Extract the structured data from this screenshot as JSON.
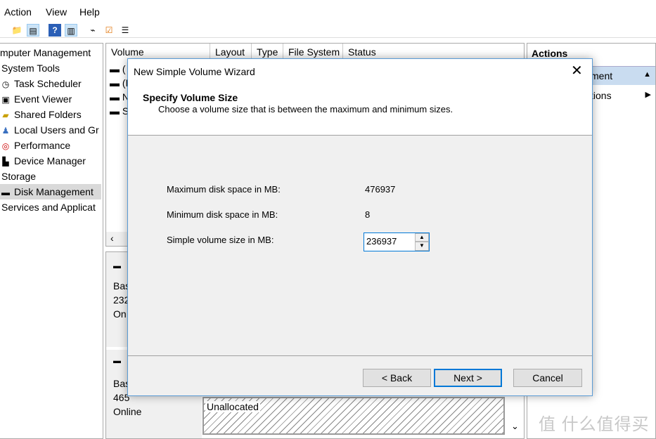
{
  "menu": [
    "Action",
    "View",
    "Help"
  ],
  "toolbar": [
    "up-folder-icon",
    "show-hide-tree-icon",
    "help-icon",
    "show-hide-action-icon",
    "connect-icon",
    "checklist-icon",
    "properties-icon"
  ],
  "tree": {
    "items": [
      {
        "label": "mputer Management",
        "icon": ""
      },
      {
        "label": "System Tools",
        "icon": ""
      },
      {
        "label": "Task Scheduler",
        "icon": "clock"
      },
      {
        "label": "Event Viewer",
        "icon": "event"
      },
      {
        "label": "Shared Folders",
        "icon": "folder"
      },
      {
        "label": "Local Users and Gr",
        "icon": "users"
      },
      {
        "label": "Performance",
        "icon": "perf"
      },
      {
        "label": "Device Manager",
        "icon": "device"
      },
      {
        "label": "Storage",
        "icon": ""
      },
      {
        "label": "Disk Management",
        "icon": "disk",
        "selected": true
      },
      {
        "label": "Services and Applicat",
        "icon": ""
      }
    ]
  },
  "list": {
    "columns": [
      "Volume",
      "Layout",
      "Type",
      "File System",
      "Status"
    ],
    "rows": [
      "(",
      "(I",
      "N",
      "S"
    ]
  },
  "lower": {
    "disk0": [
      "Bas",
      "232",
      "On"
    ],
    "disk1": [
      "Bas",
      "465",
      "Online"
    ],
    "unallocated": "Unallocated"
  },
  "actions": {
    "title": "Actions",
    "items": [
      {
        "label": "ment",
        "arrow": "▲"
      },
      {
        "label": "tions",
        "arrow": "▶"
      }
    ]
  },
  "dialog": {
    "title": "New Simple Volume Wizard",
    "heading": "Specify Volume Size",
    "subheading": "Choose a volume size that is between the maximum and minimum sizes.",
    "max_label": "Maximum disk space in MB:",
    "max_value": "476937",
    "min_label": "Minimum disk space in MB:",
    "min_value": "8",
    "size_label": "Simple volume size in MB:",
    "size_value": "236937",
    "back": "< Back",
    "next": "Next >",
    "cancel": "Cancel"
  },
  "watermark": "值 什么值得买",
  "colors": {
    "accent": "#0078d7",
    "selection": "#c9dcf0"
  }
}
